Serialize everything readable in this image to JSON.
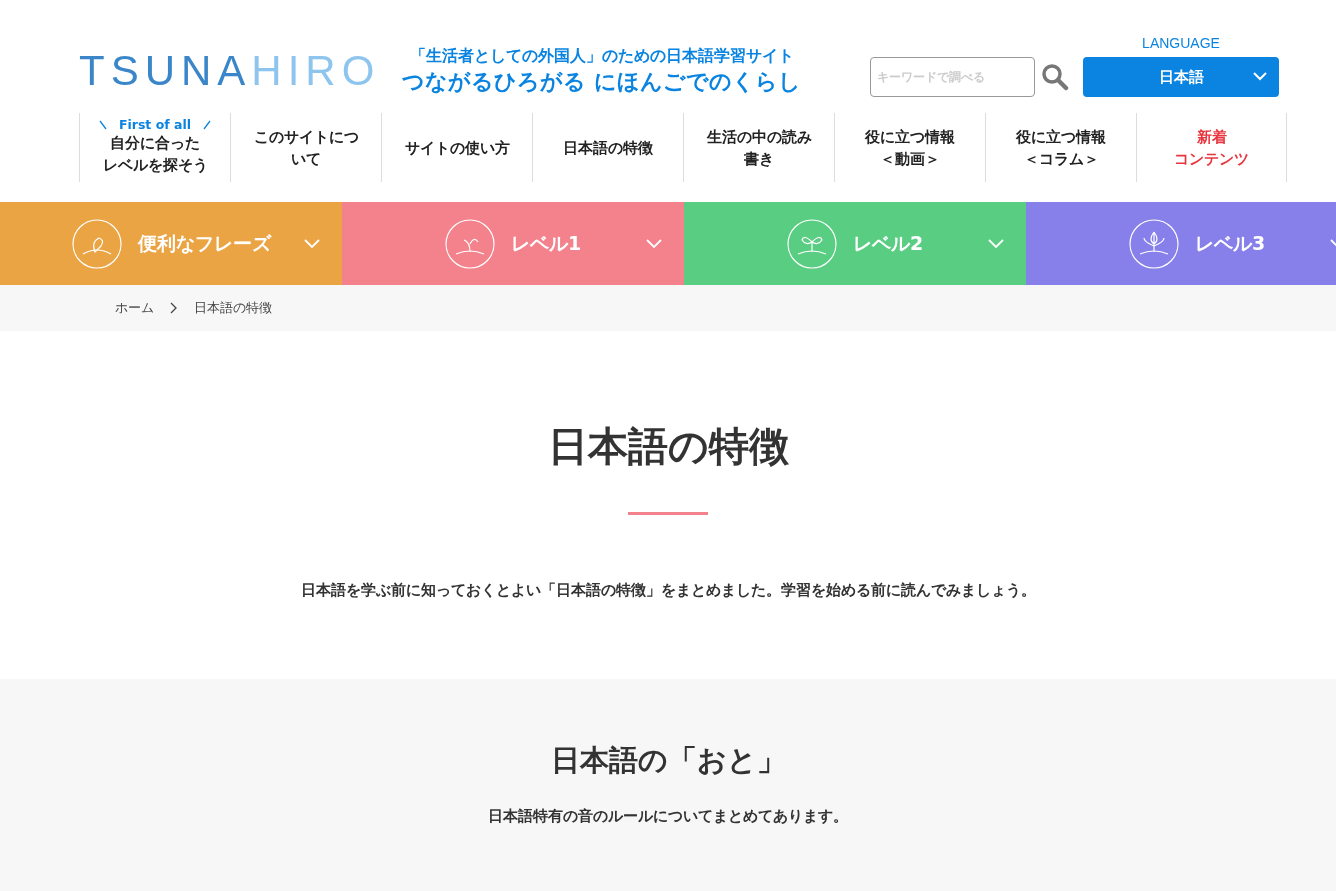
{
  "header": {
    "logo": {
      "dark": "TSUNA",
      "light": "HIRO"
    },
    "tagline": "「生活者としての外国人」のための日本語学習サイト",
    "site_title": "つながるひろがる にほんごでのくらし",
    "search": {
      "placeholder": "キーワードで調べる"
    },
    "language": {
      "label": "LANGUAGE",
      "value": "日本語"
    }
  },
  "nav": [
    {
      "lines": [
        "自分に合った",
        "レベルを探そう"
      ],
      "badge": "First of all",
      "highlight": false
    },
    {
      "lines": [
        "このサイトにつ",
        "いて"
      ],
      "highlight": false
    },
    {
      "lines": [
        "サイトの使い方"
      ],
      "highlight": false
    },
    {
      "lines": [
        "日本語の特徴"
      ],
      "highlight": false
    },
    {
      "lines": [
        "生活の中の読み",
        "書き"
      ],
      "highlight": false
    },
    {
      "lines": [
        "役に立つ情報",
        "＜動画＞"
      ],
      "highlight": false
    },
    {
      "lines": [
        "役に立つ情報",
        "＜コラム＞"
      ],
      "highlight": false
    },
    {
      "lines": [
        "新着",
        "コンテンツ"
      ],
      "highlight": true
    }
  ],
  "levels": [
    {
      "label": "便利なフレーズ",
      "color": "#eba444"
    },
    {
      "label": "レベル1",
      "color": "#f3828c"
    },
    {
      "label": "レベル2",
      "color": "#59cd82"
    },
    {
      "label": "レベル3",
      "color": "#877fea"
    }
  ],
  "breadcrumb": [
    "ホーム",
    "日本語の特徴"
  ],
  "page": {
    "title": "日本語の特徴",
    "intro": "日本語を学ぶ前に知っておくとよい「日本語の特徴」をまとめました。学習を始める前に読んでみましょう。"
  },
  "section": {
    "title": "日本語の「おと」",
    "text": "日本語特有の音のルールについてまとめてあります。"
  }
}
